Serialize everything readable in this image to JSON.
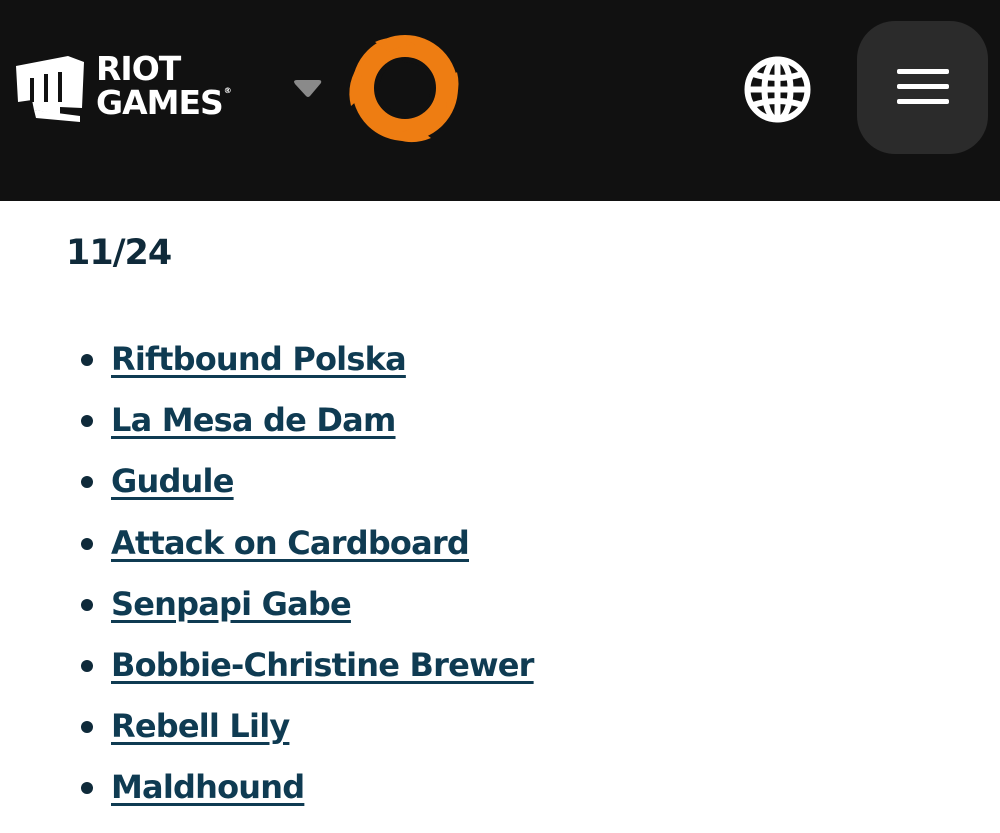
{
  "header": {
    "brand_logo_icon": "riot-fist-icon",
    "brand_line1": "RIOT",
    "brand_line2": "GAMES",
    "brand_reg_mark": "®",
    "game_switcher_icon": "chevron-down-icon",
    "game_logo_icon": "orange-swirl-logo-icon",
    "language_icon": "globe-icon",
    "menu_icon": "hamburger-menu-icon",
    "colors": {
      "bar_background": "#111111",
      "menu_button_background": "#2b2b2b",
      "game_logo_orange": "#ee7d12"
    }
  },
  "main": {
    "date_heading": "11/24",
    "creators": [
      "Riftbound Polska",
      "La Mesa de Dam",
      "Gudule",
      "Attack on Cardboard",
      "Senpapi Gabe",
      "Bobbie-Christine Brewer",
      "Rebell Lily",
      "Maldhound"
    ],
    "colors": {
      "text": "#0f2a3a",
      "link": "#0f3b52"
    }
  }
}
